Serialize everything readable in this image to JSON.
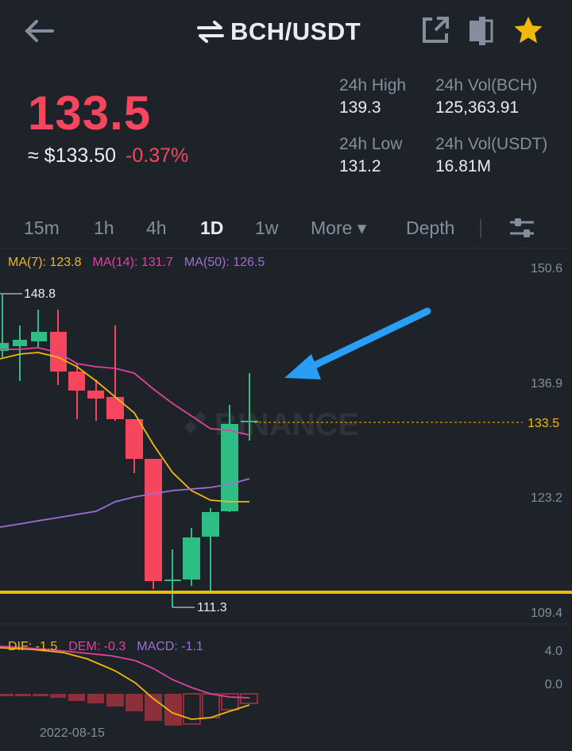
{
  "header": {
    "pair": "BCH/USDT",
    "back_icon": "arrow-left-icon",
    "swap_icon": "swap-icon",
    "share_icon": "share-icon",
    "layout_icon": "layout-icon",
    "favorite_icon": "star-icon",
    "favorite_color": "#f0b90b"
  },
  "price": {
    "last": "133.5",
    "usd": "≈ $133.50",
    "change": "-0.37%",
    "color": "#f6465d"
  },
  "stats": {
    "high_label": "24h High",
    "high_value": "139.3",
    "low_label": "24h Low",
    "low_value": "131.2",
    "vol_base_label": "24h Vol(BCH)",
    "vol_base_value": "125,363.91",
    "vol_quote_label": "24h Vol(USDT)",
    "vol_quote_value": "16.81M"
  },
  "tabs": [
    {
      "label": "15m",
      "active": false
    },
    {
      "label": "1h",
      "active": false
    },
    {
      "label": "4h",
      "active": false
    },
    {
      "label": "1D",
      "active": true
    },
    {
      "label": "1w",
      "active": false
    },
    {
      "label": "More ▾",
      "active": false
    },
    {
      "label": "Depth",
      "active": false
    }
  ],
  "settings_icon": "sliders-icon",
  "chart": {
    "ma7": "MA(7): 123.8",
    "ma14": "MA(14): 131.7",
    "ma50": "MA(50): 126.5",
    "ma7_color": "#f0b90b",
    "ma14_color": "#e040a0",
    "ma50_color": "#9b6fd6",
    "y_labels": [
      "150.6",
      "136.9",
      "123.2",
      "109.4"
    ],
    "current_price_label": "133.5",
    "high_marker": "148.8",
    "low_marker": "111.3",
    "watermark": "BINANCE",
    "up_color": "#2ebd85",
    "down_color": "#f6465d",
    "annotation_arrow_color": "#2a9df4",
    "support_line_color": "#f0b90b"
  },
  "macd": {
    "dif": "DIF: -1.5",
    "dem": "DEM: -0.3",
    "macd": "MACD: -1.1",
    "y_labels": [
      "4.0",
      "0.0"
    ],
    "date_label": "2022-08-15"
  }
}
